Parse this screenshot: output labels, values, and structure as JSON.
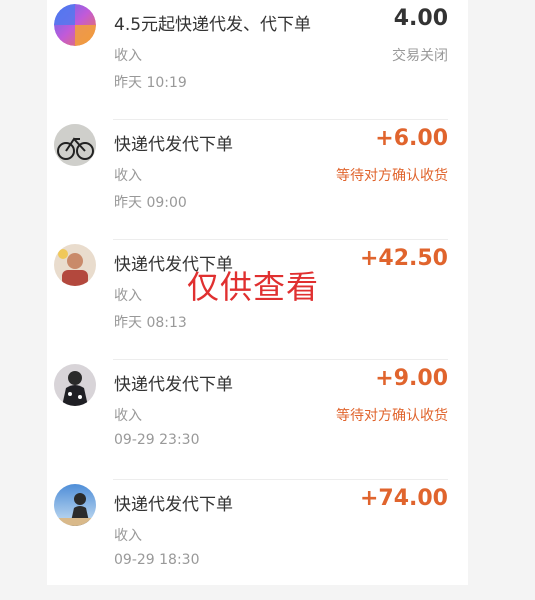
{
  "colors": {
    "accent": "#e0642d",
    "neutral_amount": "#333333",
    "muted": "#999999",
    "watermark": "#e03030"
  },
  "transactions": [
    {
      "title": "4.5元起快递代发、代下单",
      "type": "收入",
      "time": "昨天  10:19",
      "amount": "4.00",
      "status": "交易关闭",
      "avatar": "gradient-logo-avatar"
    },
    {
      "title": "快递代发代下单",
      "type": "收入",
      "time": "昨天  09:00",
      "amount": "+6.00",
      "status": "等待对方确认收货",
      "avatar": "bicycle-photo-avatar"
    },
    {
      "title": "快递代发代下单",
      "type": "收入",
      "time": "昨天  08:13",
      "amount": "+42.50",
      "status": "",
      "avatar": "person-photo-avatar"
    },
    {
      "title": "快递代发代下单",
      "type": "收入",
      "time": "09-29  23:30",
      "amount": "+9.00",
      "status": "等待对方确认收货",
      "avatar": "dark-person-avatar"
    },
    {
      "title": "快递代发代下单",
      "type": "收入",
      "time": "09-29  18:30",
      "amount": "+74.00",
      "status": "",
      "avatar": "sky-silhouette-avatar"
    }
  ],
  "watermark": "仅供查看"
}
